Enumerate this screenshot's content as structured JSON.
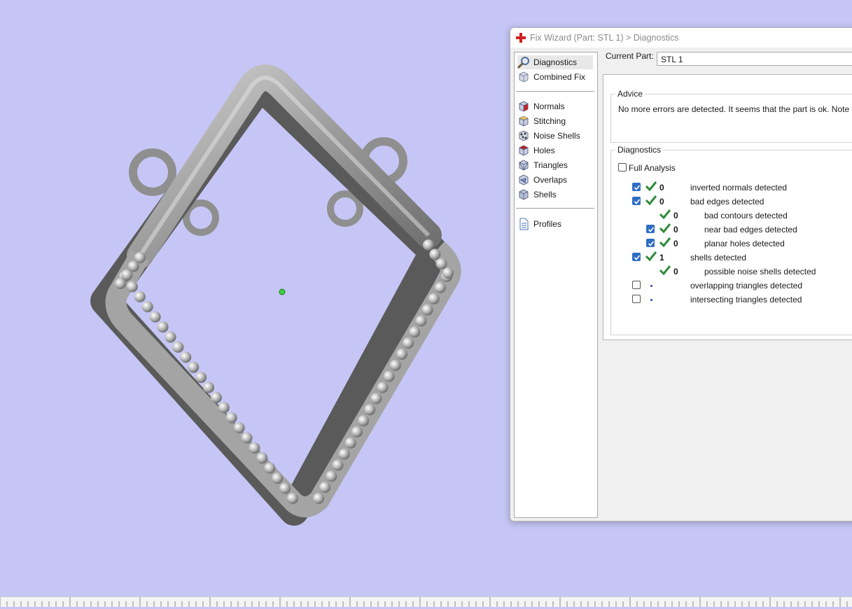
{
  "dialog": {
    "title": "Fix Wizard (Part: STL 1) > Diagnostics",
    "current_part_label": "Current Part:",
    "current_part_value": "STL 1"
  },
  "nav": {
    "top_items": [
      {
        "label": "Diagnostics",
        "icon": "magnifier-icon",
        "selected": true
      },
      {
        "label": "Combined Fix",
        "icon": "cube-icon"
      }
    ],
    "fix_items": [
      {
        "label": "Normals",
        "icon": "normals-cube-icon"
      },
      {
        "label": "Stitching",
        "icon": "stitching-cube-icon"
      },
      {
        "label": "Noise Shells",
        "icon": "noise-shells-icon"
      },
      {
        "label": "Holes",
        "icon": "holes-cube-icon"
      },
      {
        "label": "Triangles",
        "icon": "triangles-cube-icon"
      },
      {
        "label": "Overlaps",
        "icon": "overlaps-cube-icon"
      },
      {
        "label": "Shells",
        "icon": "shells-cube-icon"
      }
    ],
    "bottom_items": [
      {
        "label": "Profiles",
        "icon": "document-icon"
      }
    ]
  },
  "advice": {
    "label": "Advice",
    "text": "No more errors are detected. It seems that the part is ok. Note that r"
  },
  "diagnostics": {
    "label": "Diagnostics",
    "full_analysis_label": "Full Analysis",
    "full_analysis_checked": false,
    "rows": [
      {
        "label": "inverted normals detected",
        "count": "0",
        "checkbox": "checked",
        "status": "ok",
        "indent": 0
      },
      {
        "label": "bad edges detected",
        "count": "0",
        "checkbox": "checked",
        "status": "ok",
        "indent": 0
      },
      {
        "label": "bad contours detected",
        "count": "0",
        "checkbox": "none",
        "status": "ok",
        "indent": 1
      },
      {
        "label": "near bad edges detected",
        "count": "0",
        "checkbox": "checked",
        "status": "ok",
        "indent": 1
      },
      {
        "label": "planar holes detected",
        "count": "0",
        "checkbox": "checked",
        "status": "ok",
        "indent": 1
      },
      {
        "label": "shells detected",
        "count": "1",
        "checkbox": "checked",
        "status": "ok",
        "indent": 0
      },
      {
        "label": "possible noise shells detected",
        "count": "0",
        "checkbox": "none",
        "status": "ok",
        "indent": 1
      },
      {
        "label": "overlapping triangles detected",
        "count": "",
        "checkbox": "unchecked",
        "status": "pending",
        "indent": 0
      },
      {
        "label": "intersecting triangles detected",
        "count": "",
        "checkbox": "unchecked",
        "status": "pending",
        "indent": 0
      }
    ]
  },
  "colors": {
    "viewport_bg": "#c6c6f6",
    "model_gray": "#8c8c8c",
    "check_green": "#2e8b3a",
    "checkbox_blue": "#2f6ec4",
    "pivot_green": "#3ccf3c"
  }
}
